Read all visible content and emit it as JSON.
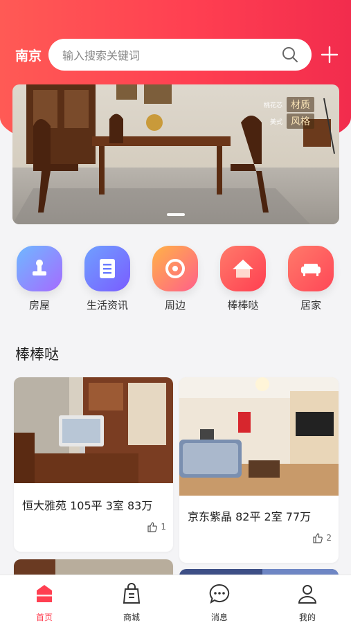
{
  "header": {
    "city": "南京",
    "search_placeholder": "输入搜索关键词"
  },
  "banner": {
    "tags": [
      {
        "small": "桃花芯",
        "big": "材质"
      },
      {
        "small": "美式",
        "big": "风格"
      }
    ]
  },
  "quick_entries": [
    {
      "label": "房屋",
      "icon": "stamp-icon",
      "color": "#8b6cff"
    },
    {
      "label": "生活资讯",
      "icon": "document-icon",
      "color": "#5b7cff"
    },
    {
      "label": "周边",
      "icon": "location-circle-icon",
      "color": "#ff7a4a"
    },
    {
      "label": "棒棒哒",
      "icon": "house-icon",
      "color": "#ff4e4e"
    },
    {
      "label": "居家",
      "icon": "sofa-icon",
      "color": "#ff5a5a"
    }
  ],
  "section": {
    "title": "棒棒哒"
  },
  "cards": [
    {
      "title": "恒大雅苑 105平 3室 83万",
      "likes": "1"
    },
    {
      "title": "京东紫晶 82平 2室 77万",
      "likes": "2"
    }
  ],
  "tabbar": {
    "items": [
      {
        "label": "首页",
        "icon": "home-icon"
      },
      {
        "label": "商城",
        "icon": "shopping-bag-icon"
      },
      {
        "label": "消息",
        "icon": "message-icon"
      },
      {
        "label": "我的",
        "icon": "user-icon"
      }
    ],
    "active_color": "#ff3f51"
  },
  "colors": {
    "brand": "#ff3f51"
  }
}
